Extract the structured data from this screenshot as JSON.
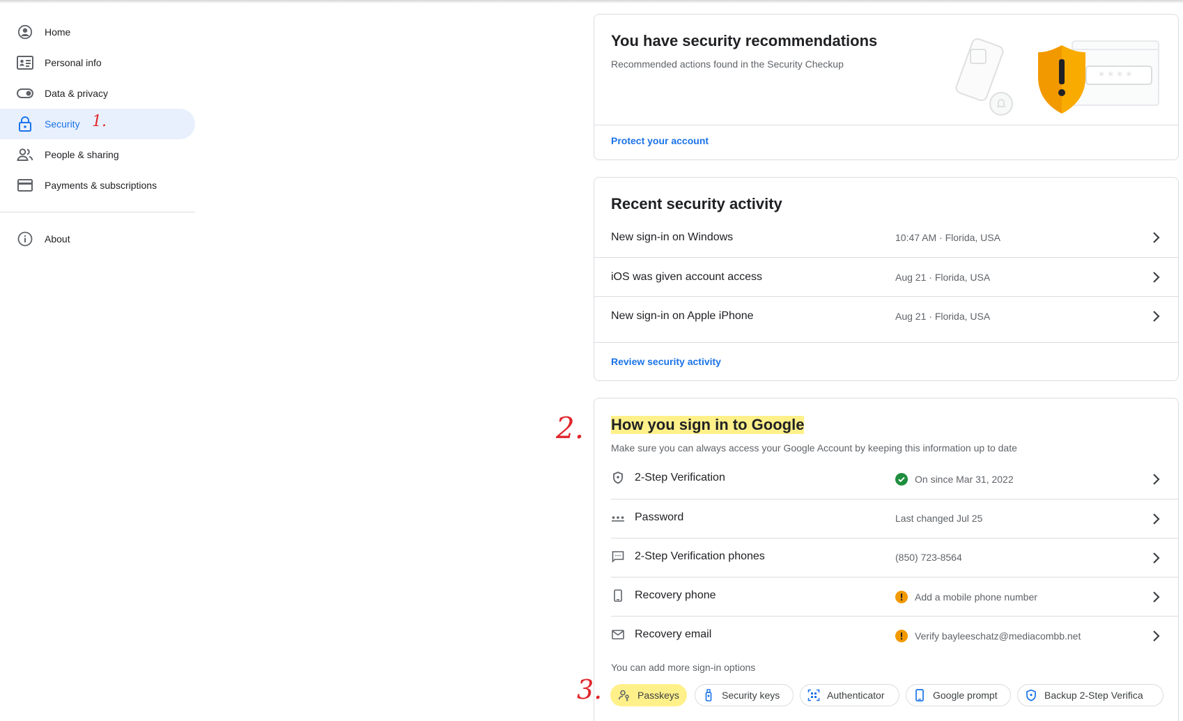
{
  "sidebar": {
    "items": [
      {
        "label": "Home",
        "icon": "account-circle-icon"
      },
      {
        "label": "Personal info",
        "icon": "id-card-icon"
      },
      {
        "label": "Data & privacy",
        "icon": "toggle-icon"
      },
      {
        "label": "Security",
        "icon": "lock-icon",
        "active": true
      },
      {
        "label": "People & sharing",
        "icon": "people-icon"
      },
      {
        "label": "Payments & subscriptions",
        "icon": "credit-card-icon"
      }
    ],
    "about": {
      "label": "About",
      "icon": "info-icon"
    }
  },
  "annotations": {
    "one": "1.",
    "two": "2.",
    "three": "3."
  },
  "recommendations": {
    "title": "You have security recommendations",
    "subtitle": "Recommended actions found in the Security Checkup",
    "link": "Protect your account"
  },
  "activity": {
    "title": "Recent security activity",
    "rows": [
      {
        "label": "New sign-in on Windows",
        "value": "10:47 AM · Florida, USA"
      },
      {
        "label": "iOS was given account access",
        "value": "Aug 21 · Florida, USA"
      },
      {
        "label": "New sign-in on Apple iPhone",
        "value": "Aug 21 · Florida, USA"
      }
    ],
    "link": "Review security activity"
  },
  "signin": {
    "title": "How you sign in to Google",
    "subtitle": "Make sure you can always access your Google Account by keeping this information up to date",
    "rows": [
      {
        "label": "2-Step Verification",
        "value": "On since Mar 31, 2022",
        "status": "ok",
        "icon": "shield-icon"
      },
      {
        "label": "Password",
        "value": "Last changed Jul 25",
        "status": "none",
        "icon": "password-dots-icon"
      },
      {
        "label": "2-Step Verification phones",
        "value": "(850) 723-8564",
        "status": "none",
        "icon": "message-icon"
      },
      {
        "label": "Recovery phone",
        "value": "Add a mobile phone number",
        "status": "warn",
        "icon": "phone-icon"
      },
      {
        "label": "Recovery email",
        "value": "Verify bayleeschatz@mediacombb.net",
        "status": "warn",
        "icon": "mail-icon"
      }
    ],
    "more_text": "You can add more sign-in options",
    "chips": [
      {
        "label": "Passkeys",
        "icon": "passkey-icon"
      },
      {
        "label": "Security keys",
        "icon": "security-key-icon"
      },
      {
        "label": "Authenticator",
        "icon": "qr-scan-icon"
      },
      {
        "label": "Google prompt",
        "icon": "phone-icon"
      },
      {
        "label": "Backup 2-Step Verifica",
        "icon": "shield-icon"
      }
    ]
  },
  "colors": {
    "accent": "#1a73e8",
    "active_bg": "#e8f0fe",
    "ok": "#1e8e3e",
    "warn": "#f29900",
    "highlight": "#fff08a",
    "annotation": "#e0262b"
  }
}
